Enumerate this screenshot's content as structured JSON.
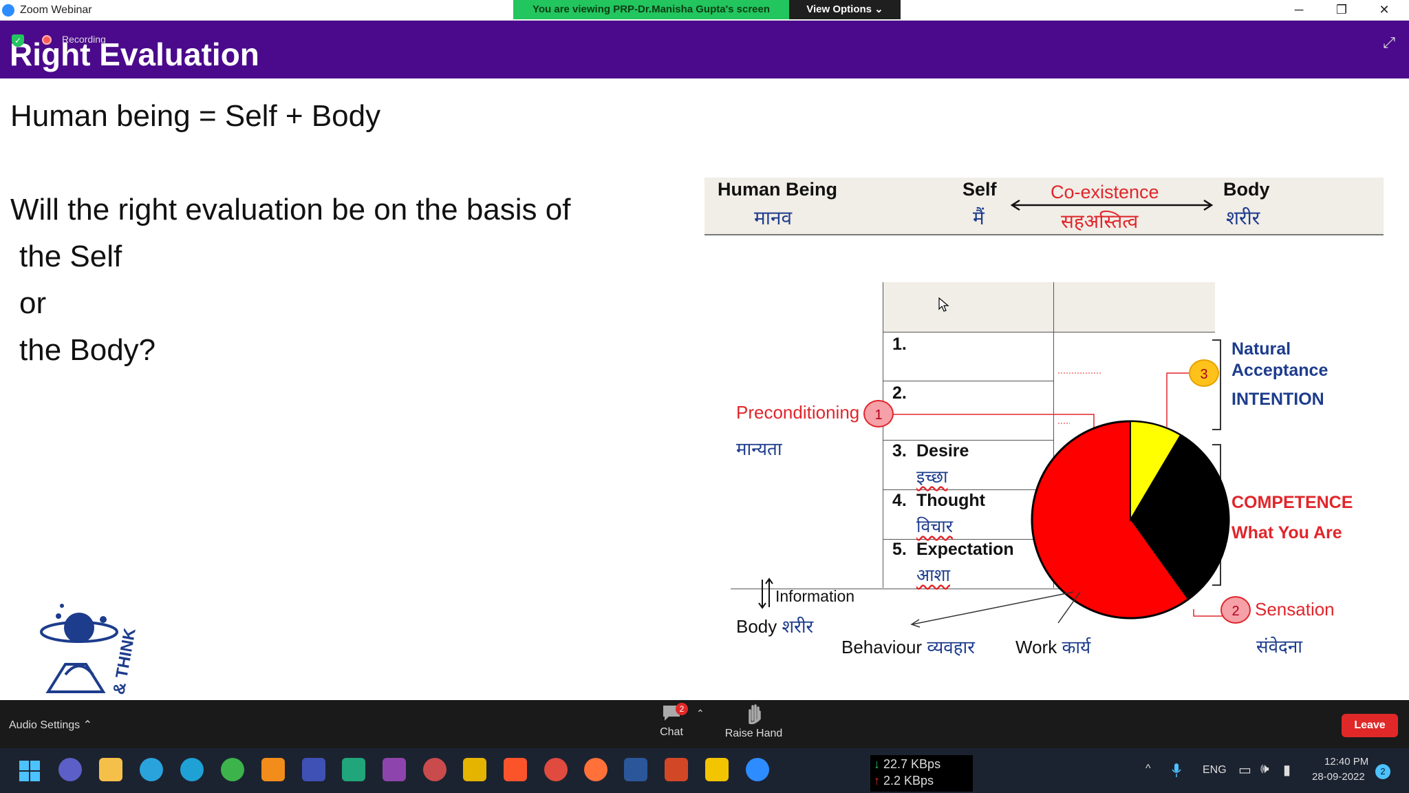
{
  "window": {
    "title": "Zoom Webinar",
    "viewing_banner": "You are viewing PRP-Dr.Manisha Gupta's screen",
    "view_options": "View Options",
    "view_options_chevron": "⌄",
    "minimize": "─",
    "restore": "❐",
    "close": "✕"
  },
  "recording": {
    "label": "Recording"
  },
  "slide": {
    "title": "Right Evaluation",
    "line1": "Human being = Self + Body",
    "q1": "Will the right evaluation be on the basis of",
    "q2": "the Self",
    "q3": "or",
    "q4": "the Body?"
  },
  "diagram": {
    "human_being": "Human Being",
    "human_being_hi": "मानव",
    "self": "Self",
    "self_hi": "मैं",
    "coexistence": "Co-existence",
    "coexistence_hi": "सहअस्तित्व",
    "body": "Body",
    "body_hi": "शरीर",
    "rows": [
      {
        "num": "1.",
        "label": "",
        "hi": ""
      },
      {
        "num": "2.",
        "label": "",
        "hi": ""
      },
      {
        "num": "3.",
        "label": "Desire",
        "hi": "इच्छा"
      },
      {
        "num": "4.",
        "label": "Thought",
        "hi": "विचार"
      },
      {
        "num": "5.",
        "label": "Expectation",
        "hi": "आशा"
      }
    ],
    "preconditioning": "Preconditioning",
    "preconditioning_hi": "मान्यता",
    "circle1": "1",
    "circle2": "2",
    "circle3": "3",
    "natural": "Natural",
    "acceptance": "Acceptance",
    "intention": "INTENTION",
    "competence": "COMPETENCE",
    "what_you_are": "What You Are",
    "sensation": "Sensation",
    "sensation_hi": "संवेदना",
    "information": "Information",
    "body_label": "Body",
    "body_label_hi": "शरीर",
    "behaviour": "Behaviour",
    "behaviour_hi": "व्यवहार",
    "work": "Work",
    "work_hi": "कार्य",
    "logo_text": "& THINK",
    "colors": {
      "red": "#ff0000",
      "yellow": "#ffff00",
      "black": "#000000"
    }
  },
  "zoom_bar": {
    "audio_settings": "Audio Settings",
    "audio_chevron": "⌃",
    "chat": "Chat",
    "chat_badge": "2",
    "chat_chevron": "⌃",
    "raise_hand": "Raise Hand",
    "leave": "Leave"
  },
  "taskbar": {
    "net_down": "22.7 KBps",
    "net_up": "2.2 KBps",
    "lang": "ENG",
    "time": "12:40 PM",
    "date": "28-09-2022",
    "notif": "2",
    "tray_chevron": "^"
  }
}
